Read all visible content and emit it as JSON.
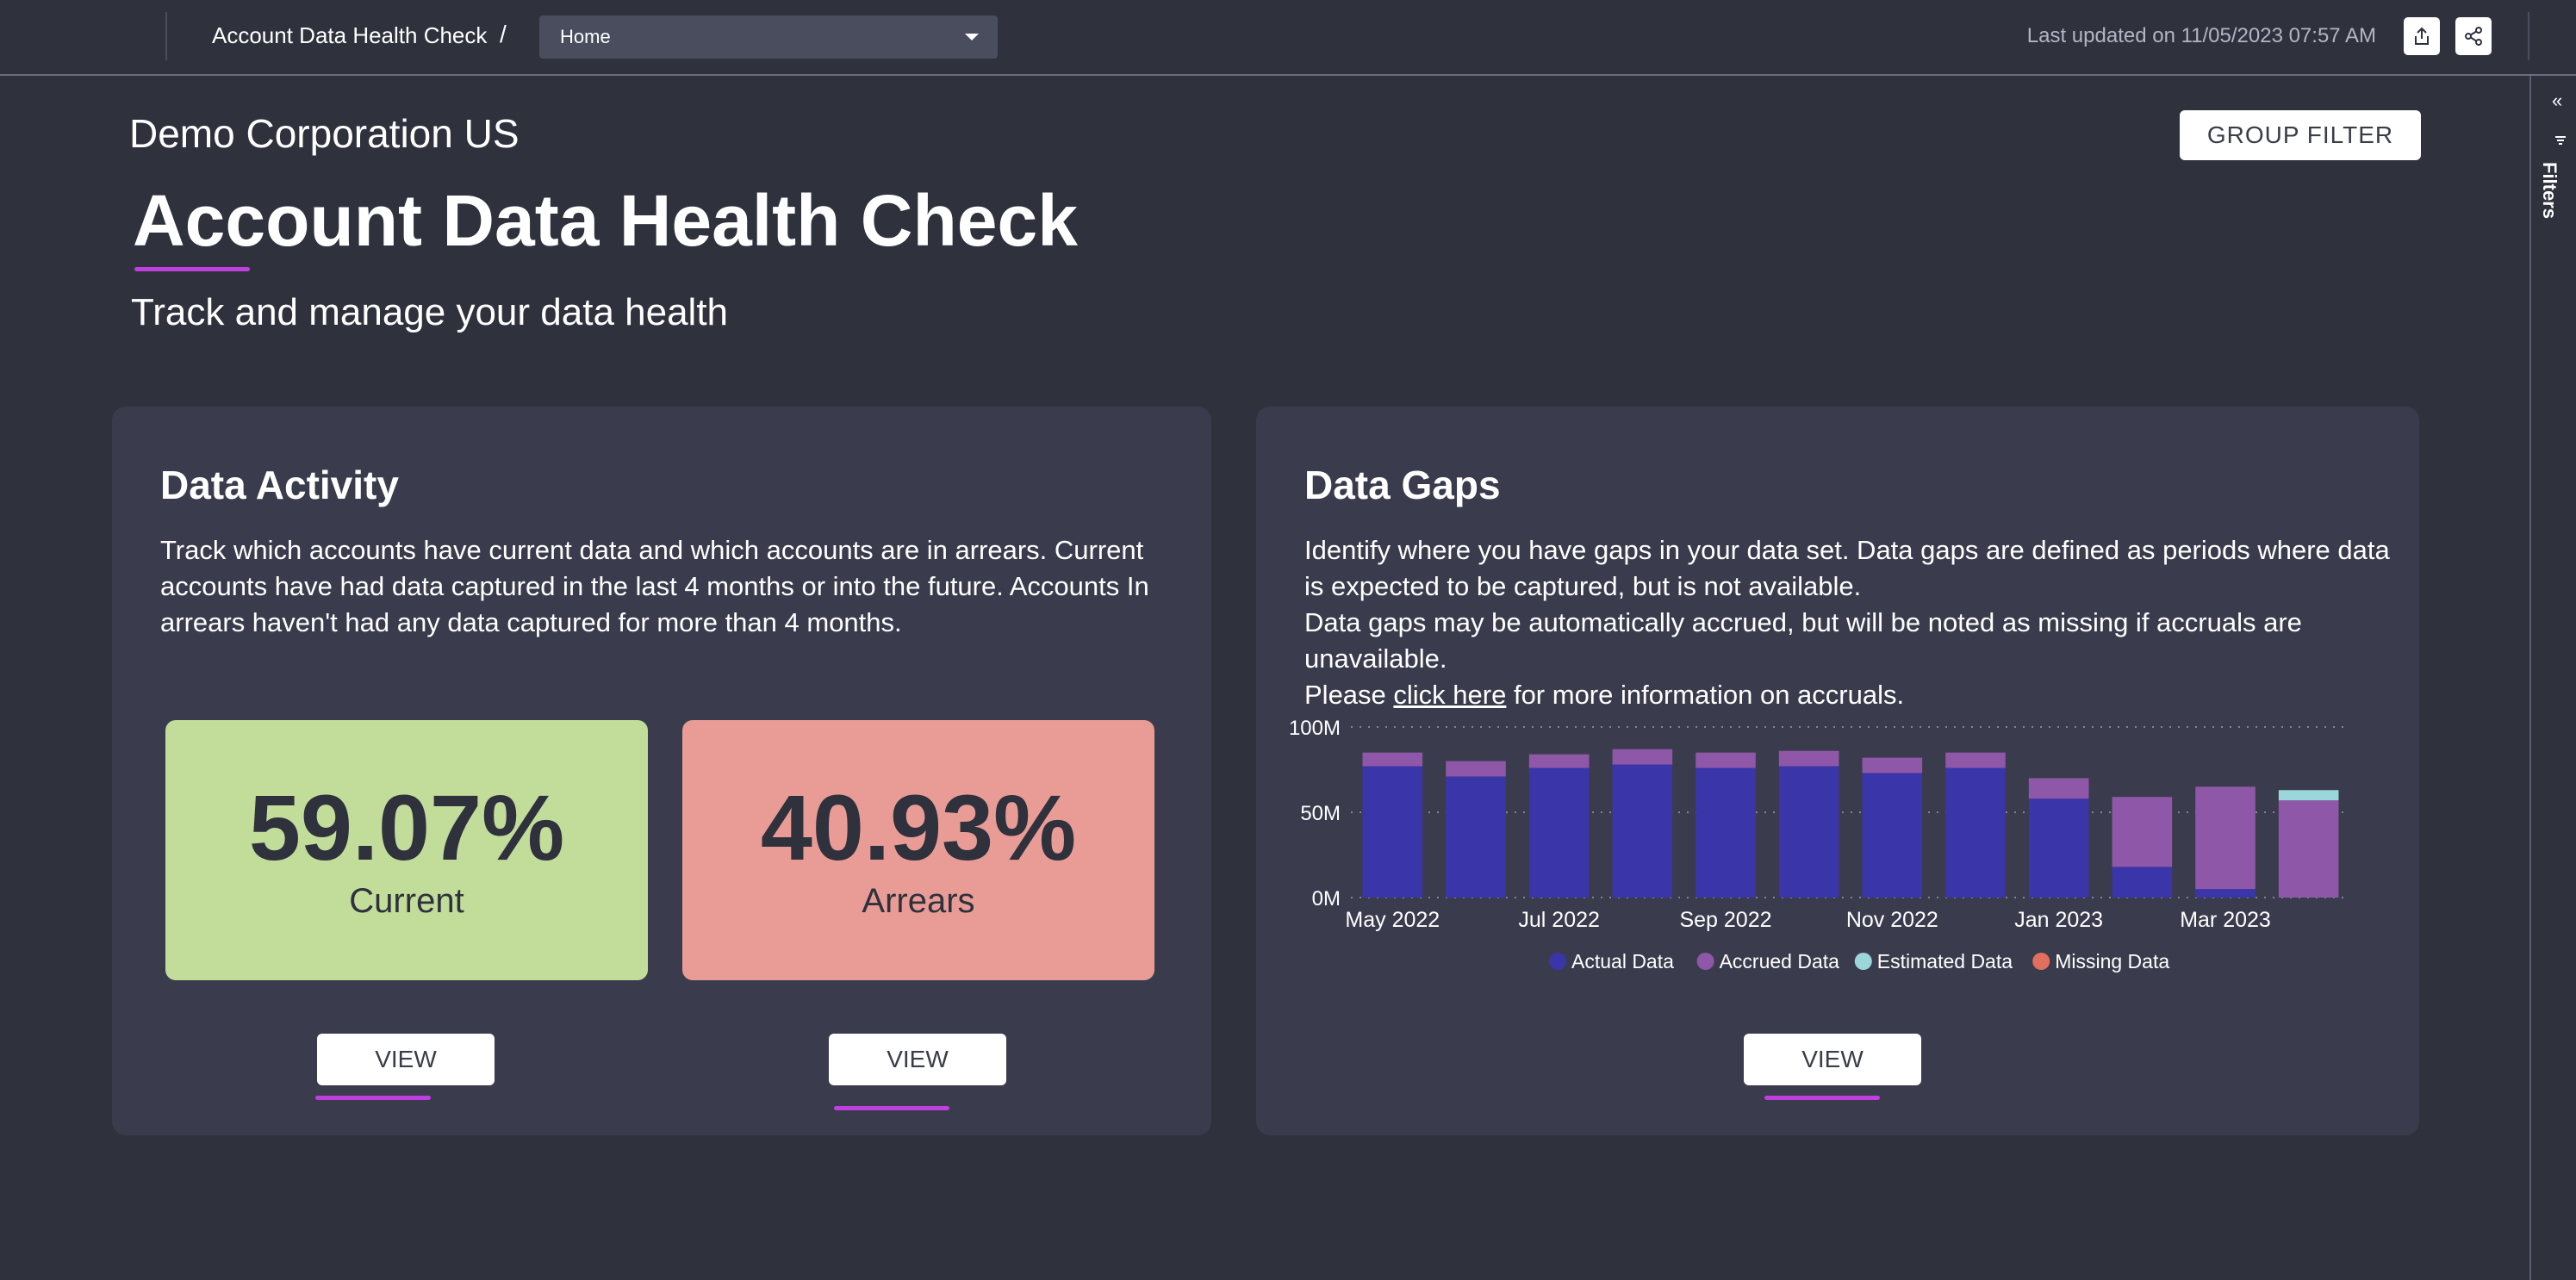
{
  "topbar": {
    "report_title": "Account Data Health Check",
    "breadcrumb_separator": "/",
    "page_select_value": "Home",
    "last_updated": "Last updated on 11/05/2023 07:57 AM",
    "export_icon": "export-icon",
    "share_icon": "share-icon"
  },
  "filters_pane": {
    "collapse_glyph": "«",
    "label": "Filters",
    "icon": "filter-icon"
  },
  "header": {
    "company": "Demo Corporation US",
    "group_filter_label": "GROUP FILTER",
    "title": "Account Data Health Check",
    "subtitle": "Track and manage your data health"
  },
  "accent_color": "#c03fe0",
  "data_activity": {
    "title": "Data Activity",
    "description": "Track which accounts have current data and which accounts are in arrears.  Current accounts have had data captured in the last 4 months or into the future.  Accounts In arrears haven't had any data captured for more than 4 months.",
    "current": {
      "value": "59.07%",
      "label": "Current",
      "color": "#c2dc9a"
    },
    "arrears": {
      "value": "40.93%",
      "label": "Arrears",
      "color": "#e99c96"
    },
    "view_current_label": "VIEW",
    "view_arrears_label": "VIEW"
  },
  "data_gaps": {
    "title": "Data Gaps",
    "description_line1": "Identify where you have gaps in your data set. Data gaps are defined as periods where data is expected to be captured, but is not available.",
    "description_line2": "Data gaps may be automatically accrued, but will be noted as missing if accruals are unavailable.",
    "description_line3_prefix": "Please ",
    "description_line3_link": "click here",
    "description_line3_suffix": " for more information on accruals.",
    "view_label": "VIEW"
  },
  "chart_data": {
    "type": "bar",
    "stacked": true,
    "categories": [
      "May 2022",
      "Jun 2022",
      "Jul 2022",
      "Aug 2022",
      "Sep 2022",
      "Oct 2022",
      "Nov 2022",
      "Dec 2022",
      "Jan 2023",
      "Feb 2023",
      "Mar 2023",
      "Apr 2023"
    ],
    "x_tick_labels": [
      "May 2022",
      "Jul 2022",
      "Sep 2022",
      "Nov 2022",
      "Jan 2023",
      "Mar 2023"
    ],
    "y_tick_labels": [
      "0M",
      "50M",
      "100M"
    ],
    "ylim": [
      0,
      100
    ],
    "grid": true,
    "legend_position": "bottom",
    "series": [
      {
        "name": "Actual Data",
        "color": "#3a35a8",
        "values": [
          77,
          71,
          76,
          78,
          76,
          77,
          73,
          76,
          58,
          18,
          5,
          0
        ]
      },
      {
        "name": "Accrued Data",
        "color": "#8f57a8",
        "values": [
          8,
          9,
          8,
          9,
          9,
          9,
          9,
          9,
          12,
          41,
          60,
          57
        ]
      },
      {
        "name": "Estimated Data",
        "color": "#9ad6da",
        "values": [
          0,
          0,
          0,
          0,
          0,
          0,
          0,
          0,
          0,
          0,
          0,
          6
        ]
      },
      {
        "name": "Missing Data",
        "color": "#e06f5f",
        "values": [
          0,
          0,
          0,
          0,
          0,
          0,
          0,
          0,
          0,
          0,
          0,
          0
        ]
      }
    ]
  }
}
